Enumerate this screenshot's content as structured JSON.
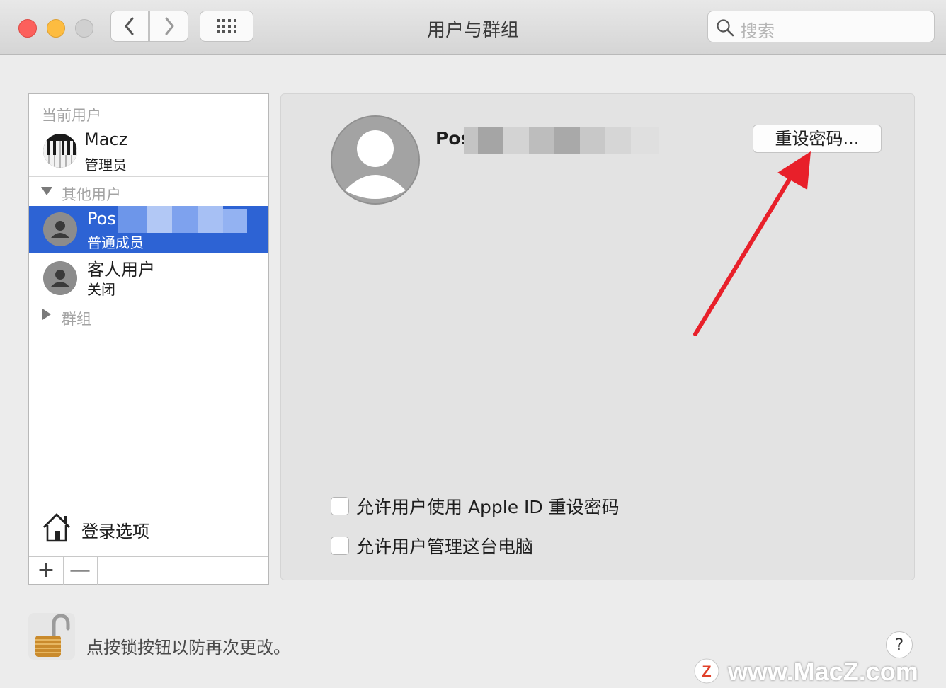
{
  "window": {
    "title": "用户与群组"
  },
  "search": {
    "placeholder": "搜索"
  },
  "sidebar": {
    "current_label": "当前用户",
    "current_user": {
      "name": "Macz",
      "role": "管理员"
    },
    "others_label": "其他用户",
    "selected_user": {
      "name": "Pos",
      "role": "普通成员"
    },
    "guest_user": {
      "name": "客人用户",
      "role": "关闭"
    },
    "groups_label": "群组",
    "login_options": "登录选项",
    "add": "+",
    "remove": "—"
  },
  "detail": {
    "user_name": "Pos",
    "reset_button": "重设密码...",
    "options": [
      {
        "label": "允许用户使用 Apple ID 重设密码",
        "checked": false
      },
      {
        "label": "允许用户管理这台电脑",
        "checked": false
      }
    ]
  },
  "footer": {
    "lock_text": "点按锁按钮以防再次更改。",
    "help": "?"
  },
  "watermark": {
    "text": "www.MacZ.com",
    "logo": "Z"
  },
  "colors": {
    "selection": "#2d63d4",
    "annotation_arrow": "#e8202a"
  }
}
